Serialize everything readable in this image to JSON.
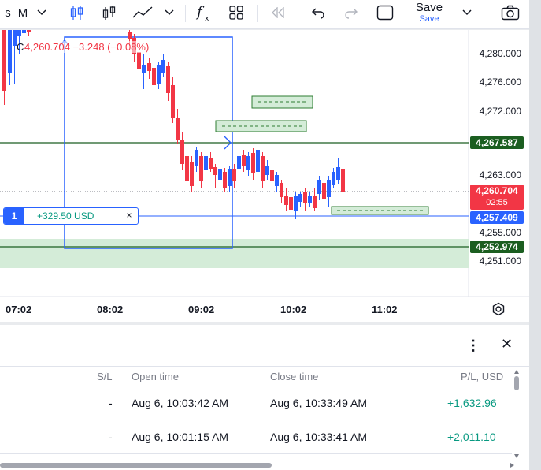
{
  "toolbar": {
    "interval_label": "M",
    "save_label": "Save",
    "save_sub": "Save"
  },
  "chart": {
    "legend_symbol": "C",
    "legend_values": "4,260.704 −3.248 (−0.08%)",
    "price_scale": [
      "4,280.000",
      "4,276.000",
      "4,272.000",
      "4,263.000",
      "4,255.000",
      "4,251.000"
    ],
    "badges": {
      "green_top": "4,267.587",
      "current_price": "4,260.704",
      "countdown": "02:55",
      "blue": "4,257.409",
      "green_bottom": "4,252.974"
    },
    "time_axis": [
      "07:02",
      "08:02",
      "09:02",
      "10:02",
      "11:02"
    ],
    "position": {
      "qty": "1",
      "pl": "+329.50 USD",
      "close": "×"
    },
    "colors": {
      "up": "#2962ff",
      "down": "#f23645",
      "green_line": "#1b5e20",
      "blue_box": "#2962ff"
    }
  },
  "panel": {
    "headers": {
      "sl": "S/L",
      "open_time": "Open time",
      "close_time": "Close time",
      "pl": "P/L, USD"
    },
    "rows": [
      {
        "sl": "-",
        "open_time": "Aug 6, 10:03:42 AM",
        "close_time": "Aug 6, 10:33:49 AM",
        "pl": "+1,632.96"
      },
      {
        "sl": "-",
        "open_time": "Aug 6, 10:01:15 AM",
        "close_time": "Aug 6, 10:33:41 AM",
        "pl": "+2,011.10"
      }
    ]
  }
}
